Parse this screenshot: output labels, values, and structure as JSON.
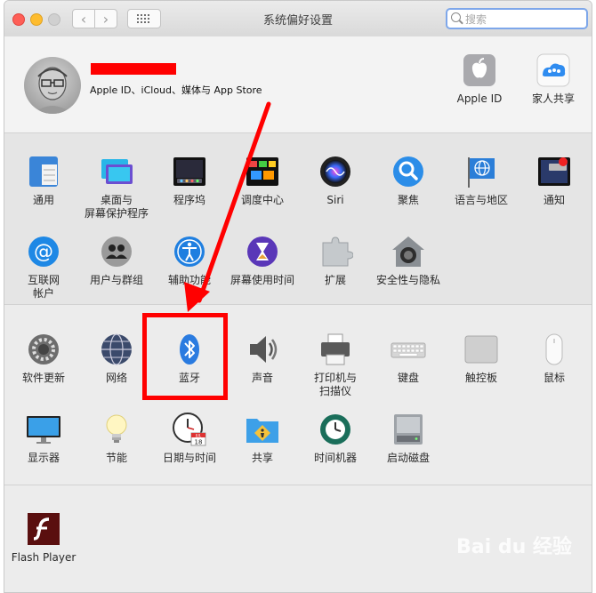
{
  "window": {
    "title": "系统偏好设置"
  },
  "search": {
    "placeholder": "搜索"
  },
  "account": {
    "subtitle": "Apple ID、iCloud、媒体与 App Store"
  },
  "top_items": {
    "apple_id": "Apple ID",
    "family": "家人共享"
  },
  "row1": [
    "通用",
    "桌面与\n屏幕保护程序",
    "程序坞",
    "调度中心",
    "Siri",
    "聚焦",
    "语言与地区",
    "通知"
  ],
  "row2": [
    "互联网\n帐户",
    "用户与群组",
    "辅助功能",
    "屏幕使用时间",
    "扩展",
    "安全性与隐私"
  ],
  "row3": [
    "软件更新",
    "网络",
    "蓝牙",
    "声音",
    "打印机与\n扫描仪",
    "键盘",
    "触控板",
    "鼠标"
  ],
  "row4": [
    "显示器",
    "节能",
    "日期与时间",
    "共享",
    "时间机器",
    "启动磁盘"
  ],
  "third_party": {
    "flash": "Flash Player"
  },
  "calendar_icon": {
    "month": "JUL",
    "day": "18"
  },
  "colors": {
    "annotation": "#ff0000",
    "search_focus": "#7ea7ea"
  },
  "watermark": {
    "text": "Bai du 经验"
  }
}
